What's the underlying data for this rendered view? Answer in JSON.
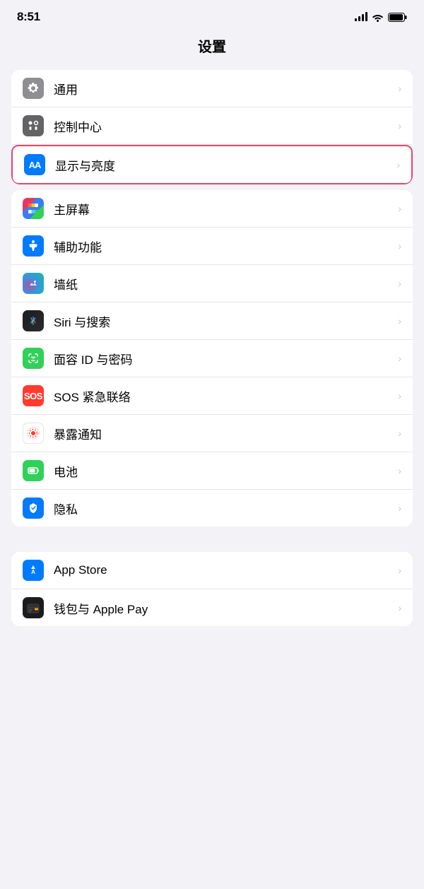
{
  "statusBar": {
    "time": "8:51",
    "signal": "signal",
    "wifi": "wifi",
    "battery": "battery"
  },
  "pageTitle": "设置",
  "groups": [
    {
      "id": "group1",
      "items": [
        {
          "id": "general",
          "label": "通用",
          "iconType": "gear",
          "iconBg": "gray",
          "highlighted": false
        },
        {
          "id": "control",
          "label": "控制中心",
          "iconType": "control",
          "iconBg": "gray2",
          "highlighted": false
        },
        {
          "id": "display",
          "label": "显示与亮度",
          "iconType": "aa",
          "iconBg": "blue",
          "highlighted": true
        }
      ]
    },
    {
      "id": "group2",
      "items": [
        {
          "id": "homescreen",
          "label": "主屏幕",
          "iconType": "home",
          "iconBg": "purple",
          "highlighted": false
        },
        {
          "id": "accessibility",
          "label": "辅助功能",
          "iconType": "accessibility",
          "iconBg": "blue2",
          "highlighted": false
        },
        {
          "id": "wallpaper",
          "label": "墙纸",
          "iconType": "wallpaper",
          "iconBg": "wallpaper",
          "highlighted": false
        },
        {
          "id": "siri",
          "label": "Siri 与搜索",
          "iconType": "siri",
          "iconBg": "siri",
          "highlighted": false
        },
        {
          "id": "faceid",
          "label": "面容 ID 与密码",
          "iconType": "faceid",
          "iconBg": "green",
          "highlighted": false
        },
        {
          "id": "sos",
          "label": "SOS 紧急联络",
          "iconType": "sos",
          "iconBg": "red",
          "highlighted": false
        },
        {
          "id": "exposure",
          "label": "暴露通知",
          "iconType": "exposure",
          "iconBg": "white",
          "highlighted": false
        },
        {
          "id": "battery",
          "label": "电池",
          "iconType": "battery",
          "iconBg": "green2",
          "highlighted": false
        },
        {
          "id": "privacy",
          "label": "隐私",
          "iconType": "privacy",
          "iconBg": "blue3",
          "highlighted": false
        }
      ]
    },
    {
      "id": "group3",
      "items": [
        {
          "id": "appstore",
          "label": "App Store",
          "iconType": "appstore",
          "iconBg": "blue",
          "highlighted": false
        },
        {
          "id": "wallet",
          "label": "钱包与 Apple Pay",
          "iconType": "wallet",
          "iconBg": "black",
          "highlighted": false
        }
      ]
    }
  ],
  "chevron": "›"
}
